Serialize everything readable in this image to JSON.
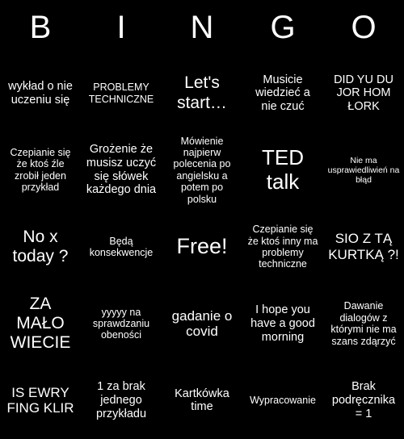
{
  "card": {
    "background_color": "#000000",
    "text_color": "#ffffff",
    "header": {
      "letters": [
        "B",
        "I",
        "N",
        "G",
        "O"
      ]
    },
    "cells": [
      {
        "text": "",
        "size": "m"
      },
      {
        "text": "wykład o nie uczeniu się",
        "size": "m"
      },
      {
        "text": "PROBLEMY TECHNICZNE",
        "size": "s"
      },
      {
        "text": "Let's start…",
        "size": "xl"
      },
      {
        "text": "Musicie wiedzieć a nie czuć",
        "size": "m"
      },
      {
        "text": "DID YU DU JOR HOM ŁORK",
        "size": "m"
      },
      {
        "text": "Czepianie się że ktoś źle zrobił jeden przykład",
        "size": "s"
      },
      {
        "text": "Grożenie że musisz uczyć się słówek każdego dnia",
        "size": "m"
      },
      {
        "text": "Mówienie najpierw polecenia po angielsku a potem po polsku",
        "size": "s"
      },
      {
        "text": "TED talk",
        "size": "xxl"
      },
      {
        "text": "Nie ma usprawiedliwień na błąd",
        "size": "xs"
      },
      {
        "text": "No x today ?",
        "size": "xl"
      },
      {
        "text": "Będą konsekwencje",
        "size": "s"
      },
      {
        "text": "Free!",
        "size": "free"
      },
      {
        "text": "Czepianie się że ktoś inny ma problemy techniczne",
        "size": "s"
      },
      {
        "text": "SIO Z TĄ KURTKĄ ?!",
        "size": "l"
      },
      {
        "text": "ZA MAŁO WIECIE",
        "size": "xl"
      },
      {
        "text": "yyyyy na sprawdzaniu obeności",
        "size": "s"
      },
      {
        "text": "gadanie o covid",
        "size": "l"
      },
      {
        "text": "I hope you have a good morning",
        "size": "m"
      },
      {
        "text": "Dawanie dialogów z którymi nie ma szans zdąrzyć",
        "size": "s"
      },
      {
        "text": "IS EWRY FING KLIR",
        "size": "l"
      },
      {
        "text": "1 za brak jednego przykładu",
        "size": "m"
      },
      {
        "text": "Kartkówka time",
        "size": "m"
      },
      {
        "text": "Wypracowanie",
        "size": "s"
      },
      {
        "text": "Brak podręcznika = 1",
        "size": "m"
      }
    ],
    "rows": [
      [
        {
          "text": "wykład o nie uczeniu się",
          "size": "m"
        },
        {
          "text": "PROBLEMY TECHNICZNE",
          "size": "s"
        },
        {
          "text": "Let's start…",
          "size": "xl"
        },
        {
          "text": "Musicie wiedzieć a nie czuć",
          "size": "m"
        },
        {
          "text": "DID YU DU JOR HOM ŁORK",
          "size": "m"
        }
      ],
      [
        {
          "text": "Czepianie się że ktoś źle zrobił jeden przykład",
          "size": "s"
        },
        {
          "text": "Grożenie że musisz uczyć się słówek każdego dnia",
          "size": "m"
        },
        {
          "text": "Mówienie najpierw polecenia po angielsku a potem po polsku",
          "size": "s"
        },
        {
          "text": "TED talk",
          "size": "xxl"
        },
        {
          "text": "Nie ma usprawiedliwień na błąd",
          "size": "xs"
        }
      ],
      [
        {
          "text": "No x today ?",
          "size": "xl"
        },
        {
          "text": "Będą konsekwencje",
          "size": "s"
        },
        {
          "text": "Free!",
          "size": "free"
        },
        {
          "text": "Czepianie się że ktoś inny ma problemy techniczne",
          "size": "s"
        },
        {
          "text": "SIO Z TĄ KURTKĄ ?!",
          "size": "l"
        }
      ],
      [
        {
          "text": "ZA MAŁO WIECIE",
          "size": "xl"
        },
        {
          "text": "yyyyy na sprawdzaniu obeności",
          "size": "s"
        },
        {
          "text": "gadanie o covid",
          "size": "l"
        },
        {
          "text": "I hope you have a good morning",
          "size": "m"
        },
        {
          "text": "Dawanie dialogów z którymi nie ma szans zdąrzyć",
          "size": "s"
        }
      ],
      [
        {
          "text": "IS EWRY FING KLIR",
          "size": "l"
        },
        {
          "text": "1 za brak jednego przykładu",
          "size": "m"
        },
        {
          "text": "Kartkówka time",
          "size": "m"
        },
        {
          "text": "Wypracowanie",
          "size": "s"
        },
        {
          "text": "Brak podręcznika = 1",
          "size": "m"
        }
      ]
    ]
  }
}
